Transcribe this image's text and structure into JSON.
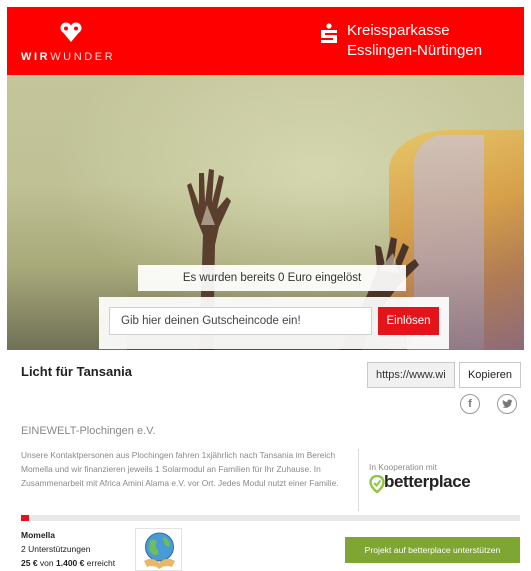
{
  "header": {
    "left_brand": {
      "part_bold": "WIR",
      "part_light": "WUNDER",
      "icon": "wirwunder-heart-icon"
    },
    "right_brand": {
      "line1": "Kreissparkasse",
      "line2": "Esslingen-Nürtingen",
      "icon": "sparkasse-s-icon"
    },
    "background_color": "#ff0000"
  },
  "hero": {
    "redeemed_text": "Es wurden bereits 0 Euro eingelöst",
    "voucher_placeholder": "Gib hier deinen Gutscheincode ein!",
    "redeem_button": "Einlösen"
  },
  "project": {
    "title": "Licht für Tansania",
    "share_url": "https://www.wi",
    "copy_button": "Kopieren",
    "share_icons": [
      "facebook-icon",
      "twitter-icon"
    ],
    "organization": "EINEWELT-Plochingen e.V.",
    "description": "Unsere Kontaktpersonen aus Plochingen fahren 1xjährlich nach Tansania im Bereich Momella und wir finanzieren jeweils 1 Solarmodul an Familien für Ihr Zuhause. In Zusammenarbeit mit Africa Amini Alama e.V. vor Ort. Jedes Modul nutzt einer Familie.",
    "cooperation_label": "In Kooperation mit",
    "partner_name": "betterplace"
  },
  "funding": {
    "progress_fraction": 0.017,
    "location": "Momella",
    "supporters": "2 Unterstützungen",
    "amount_raised": "25 €",
    "amount_connector": "von",
    "amount_goal": "1.400 €",
    "amount_suffix": "erreicht",
    "support_button": "Projekt auf betterplace unterstützen"
  },
  "colors": {
    "accent_red": "#e4151a",
    "support_green": "#7fa532",
    "partner_green": "#8dc63f"
  }
}
